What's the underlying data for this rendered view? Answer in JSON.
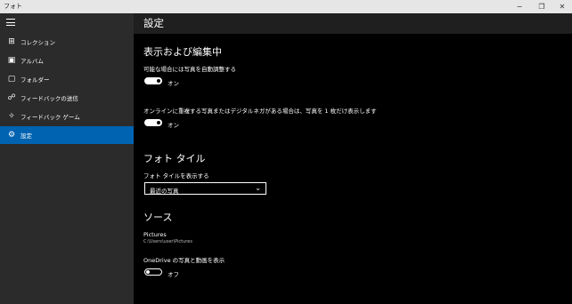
{
  "window": {
    "title": "フォト",
    "minimize": "−",
    "maximize": "❐",
    "close": "✕"
  },
  "sidebar": {
    "menu_icon": "hamburger-icon",
    "items": [
      {
        "label": "コレクション",
        "icon": "collection-icon",
        "glyph": "⊞"
      },
      {
        "label": "アルバム",
        "icon": "album-icon",
        "glyph": "▣"
      },
      {
        "label": "フォルダー",
        "icon": "folder-icon",
        "glyph": "▢"
      },
      {
        "label": "フィードバックの送信",
        "icon": "feedback-icon",
        "glyph": "☍"
      },
      {
        "label": "フィードバック ゲーム",
        "icon": "feedback-game-icon",
        "glyph": "✧"
      },
      {
        "label": "設定",
        "icon": "gear-icon",
        "glyph": "⚙",
        "active": true
      }
    ]
  },
  "header": {
    "title": "設定"
  },
  "sections": {
    "viewing": {
      "heading": "表示および編集中",
      "auto_enhance_label": "可能な場合には写真を自動調整する",
      "auto_enhance_state": "オン",
      "duplicates_label": "オンラインに重複する写真またはデジタルネガがある場合は、写真を 1 枚だけ表示します",
      "duplicates_state": "オン"
    },
    "live_tile": {
      "heading": "フォト タイル",
      "show_label": "フォト タイルを表示する",
      "selected": "最近の写真"
    },
    "sources": {
      "heading": "ソース",
      "folder_name": "Pictures",
      "folder_path": "C:\\Users\\user\\Pictures",
      "onedrive_label": "OneDrive の写真と動画を表示",
      "onedrive_state": "オフ"
    }
  },
  "colors": {
    "accent": "#0063b1",
    "sidebar_bg": "#2b2b2b",
    "header_bg": "#1f1f1f"
  }
}
